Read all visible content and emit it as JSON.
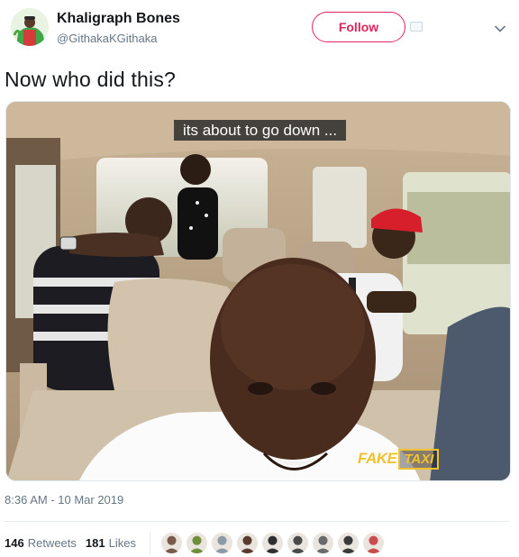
{
  "author": {
    "name": "Khaligraph Bones",
    "handle": "@GithakaKGithaka",
    "avatar_icon": "profile-avatar"
  },
  "follow_button": {
    "label": "Follow",
    "color": "#e0245e"
  },
  "menu_icon": "chevron-down-icon",
  "tweet": {
    "text": "Now who did this?",
    "media": {
      "caption": "its about to go down ...",
      "watermark_part1": "FAKE",
      "watermark_part2": "TAXI",
      "watermark_color": "#f2c12e"
    },
    "timestamp": "8:36 AM - 10 Mar 2019"
  },
  "stats": {
    "retweets_count": "146",
    "retweets_label": "Retweets",
    "likes_count": "181",
    "likes_label": "Likes"
  },
  "likers": [
    {
      "name": "liker-avatar-1",
      "color": "#7a5a4a"
    },
    {
      "name": "liker-avatar-2",
      "color": "#6f8f3a"
    },
    {
      "name": "liker-avatar-3",
      "color": "#8c9aa8"
    },
    {
      "name": "liker-avatar-4",
      "color": "#5a3a2a"
    },
    {
      "name": "liker-avatar-5",
      "color": "#2f2f2f"
    },
    {
      "name": "liker-avatar-6",
      "color": "#4a4a4a"
    },
    {
      "name": "liker-avatar-7",
      "color": "#6a6a6a"
    },
    {
      "name": "liker-avatar-8",
      "color": "#3a3a3a"
    },
    {
      "name": "liker-avatar-9",
      "color": "#c94b4b"
    }
  ]
}
